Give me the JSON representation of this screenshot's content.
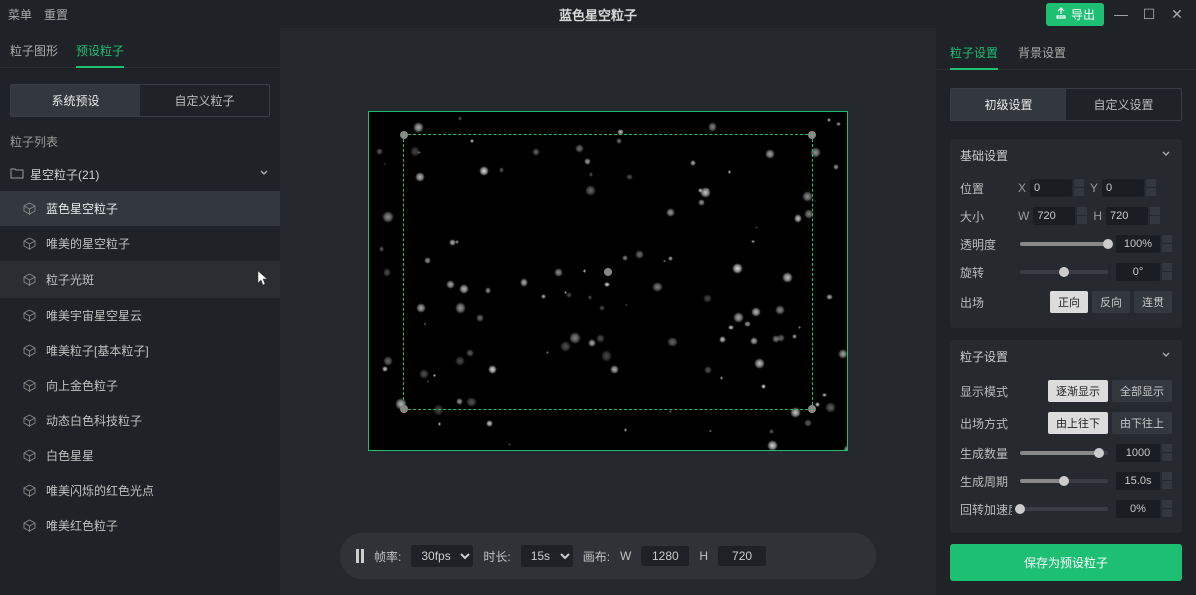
{
  "titlebar": {
    "menu": "菜单",
    "reset": "重置",
    "title": "蓝色星空粒子",
    "export": "导出"
  },
  "left": {
    "tabs": [
      "粒子图形",
      "预设粒子"
    ],
    "presetTabs": [
      "系统预设",
      "自定义粒子"
    ],
    "listLabel": "粒子列表",
    "folder": "星空粒子(21)",
    "items": [
      "蓝色星空粒子",
      "唯美的星空粒子",
      "粒子光斑",
      "唯美宇宙星空星云",
      "唯美粒子[基本粒子]",
      "向上金色粒子",
      "动态白色科技粒子",
      "白色星星",
      "唯美闪烁的红色光点",
      "唯美红色粒子"
    ],
    "activeIndex": 0,
    "hoverIndex": 2
  },
  "bottom": {
    "frameRateLabel": "帧率:",
    "frameRate": "30fps",
    "durationLabel": "时长:",
    "duration": "15s",
    "canvasLabel": "画布:",
    "wLabel": "W",
    "w": "1280",
    "hLabel": "H",
    "h": "720"
  },
  "right": {
    "tabs": [
      "粒子设置",
      "背景设置"
    ],
    "subtabs": [
      "初级设置",
      "自定义设置"
    ],
    "basic": {
      "title": "基础设置",
      "position": "位置",
      "x": "0",
      "y": "0",
      "size": "大小",
      "w": "720",
      "h": "720",
      "opacity": "透明度",
      "opacityVal": "100%",
      "rotate": "旋转",
      "rotateVal": "0°",
      "exit": "出场",
      "exitBtns": [
        "正向",
        "反向",
        "连贯"
      ]
    },
    "particle": {
      "title": "粒子设置",
      "displayMode": "显示模式",
      "displayBtns": [
        "逐渐显示",
        "全部显示"
      ],
      "exitMode": "出场方式",
      "exitBtns": [
        "由上往下",
        "由下往上"
      ],
      "genCount": "生成数量",
      "genCountVal": "1000",
      "genCycle": "生成周期",
      "genCycleVal": "15.0s",
      "unknown": "回转加速度",
      "unknownVal": "0%"
    },
    "save": "保存为预设粒子"
  }
}
